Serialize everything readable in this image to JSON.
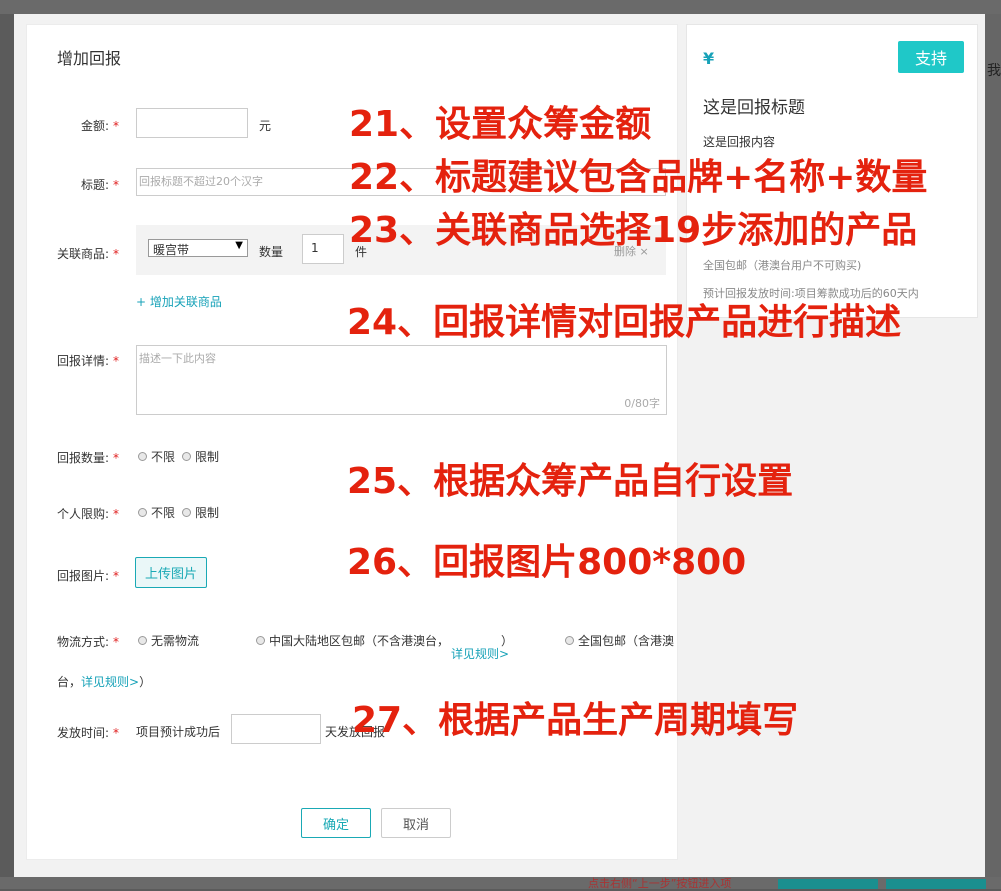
{
  "background": {
    "logo_text": "",
    "side_char": "我",
    "bottom_hint": "点击右侧“上一步”按钮进入项"
  },
  "modal": {
    "title": "增加回报",
    "amount": {
      "label": "金额:",
      "unit": "元",
      "value": ""
    },
    "headline": {
      "label": "标题:",
      "placeholder": "回报标题不超过20个汉字"
    },
    "goods": {
      "label": "关联商品:",
      "selected": "暖宫带",
      "qty_label": "数量",
      "qty_value": "1",
      "unit": "件",
      "delete": "删除 ×",
      "add_link": "+ 增加关联商品"
    },
    "details": {
      "label": "回报详情:",
      "placeholder": "描述一下此内容",
      "counter": "0/80字"
    },
    "reward_count": {
      "label": "回报数量:",
      "opt1": "不限",
      "opt2": "限制"
    },
    "personal_limit": {
      "label": "个人限购:",
      "opt1": "不限",
      "opt2": "限制"
    },
    "image": {
      "label": "回报图片:",
      "upload_button": "上传图片"
    },
    "logistics": {
      "label": "物流方式:",
      "opt1": "无需物流",
      "opt2": "中国大陆地区包邮（不含港澳台，",
      "opt2_link": "详见规则>",
      "opt2_close": "）",
      "opt3": "全国包邮（含港澳",
      "opt3_tail": "台，",
      "opt3_link": "详见规则>",
      "opt3_close": "）"
    },
    "dispatch": {
      "label": "发放时间:",
      "prefix": "项目预计成功后",
      "suffix": "天发放回报"
    },
    "ok_button": "确定",
    "cancel_button": "取消"
  },
  "preview": {
    "currency": "¥",
    "support_button": "支持",
    "title": "这是回报标题",
    "content": "这是回报内容",
    "shipping": "全国包邮（港澳台用户不可购买)",
    "dispatch_time": "预计回报发放时间:项目筹款成功后的60天内"
  },
  "annotations": [
    "21、设置众筹金额",
    "22、标题建议包含品牌+名称+数量",
    "23、关联商品选择19步添加的产品",
    "24、回报详情对回报产品进行描述",
    "25、根据众筹产品自行设置",
    "26、回报图片800*800",
    "27、根据产品生产周期填写"
  ],
  "colors": {
    "accent": "#1aa9b5",
    "support_bg": "#1fc8c8",
    "required": "#e02020",
    "annotation": "#e4220e",
    "overlay": "#5b5b5b"
  }
}
